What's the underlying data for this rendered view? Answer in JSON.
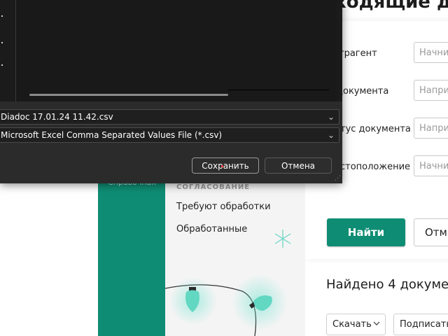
{
  "page": {
    "title": "ходящие до",
    "filters": [
      {
        "label": "трагент",
        "placeholder": "Начни"
      },
      {
        "label": "документа",
        "placeholder": "Напри"
      },
      {
        "label": "тус документа",
        "placeholder": "Напри"
      },
      {
        "label": "стоположение",
        "placeholder": "Начни"
      }
    ],
    "find_label": "Найти",
    "reset_label": "Отм",
    "found_text": "Найдено 4 докуме",
    "download_label": "Скачать",
    "sign_label": "Подписать"
  },
  "sidebar": {
    "label": "Справочная"
  },
  "nav": {
    "section": "СОГЛАСОВАНИЕ",
    "items": [
      "Требуют обработки",
      "Обработанные"
    ]
  },
  "dialog": {
    "filename": "Diadoc 17.01.24 11.42.csv",
    "filetype": "Microsoft Excel Comma Separated Values File (*.csv)",
    "save_label": "Сохранить",
    "cancel_label": "Отмена",
    "chevron": "⌄"
  },
  "colors": {
    "brand_green": "#0f8d74",
    "dialog_bg": "#202020"
  }
}
